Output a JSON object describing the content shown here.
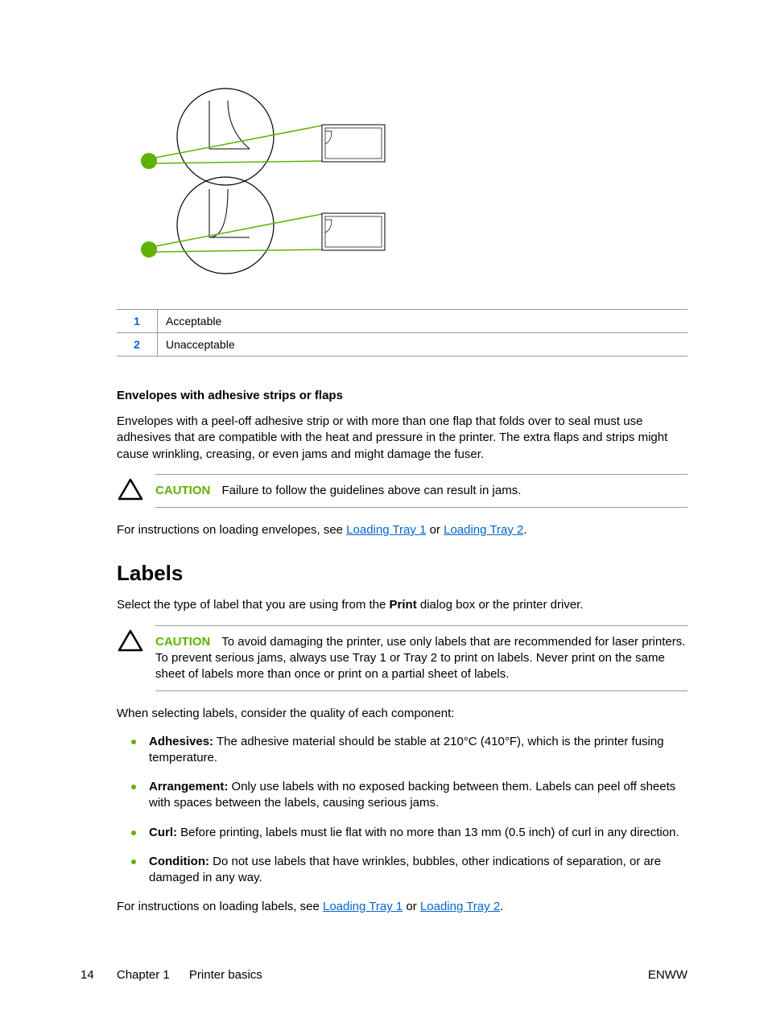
{
  "legend": {
    "row1_num": "1",
    "row1_text": "Acceptable",
    "row2_num": "2",
    "row2_text": "Unacceptable"
  },
  "sub_heading": "Envelopes with adhesive strips or flaps",
  "para_env": "Envelopes with a peel-off adhesive strip or with more than one flap that folds over to seal must use adhesives that are compatible with the heat and pressure in the printer. The extra flaps and strips might cause wrinkling, creasing, or even jams and might damage the fuser.",
  "caution1": {
    "label": "CAUTION",
    "text": "Failure to follow the guidelines above can result in jams."
  },
  "loading_env": {
    "pre": "For instructions on loading envelopes, see ",
    "link1": "Loading Tray 1",
    "or": " or ",
    "link2": "Loading Tray 2",
    "post": "."
  },
  "section_title": "Labels",
  "para_labels_intro_pre": "Select the type of label that you are using from the ",
  "para_labels_intro_bold": "Print",
  "para_labels_intro_post": " dialog box or the printer driver.",
  "caution2": {
    "label": "CAUTION",
    "text": "To avoid damaging the printer, use only labels that are recommended for laser printers. To prevent serious jams, always use Tray 1 or Tray 2 to print on labels. Never print on the same sheet of labels more than once or print on a partial sheet of labels."
  },
  "para_when": "When selecting labels, consider the quality of each component:",
  "bullets": {
    "b1_label": "Adhesives:",
    "b1_text": " The adhesive material should be stable at 210°C (410°F), which is the printer fusing temperature.",
    "b2_label": "Arrangement:",
    "b2_text": " Only use labels with no exposed backing between them. Labels can peel off sheets with spaces between the labels, causing serious jams.",
    "b3_label": "Curl:",
    "b3_text": " Before printing, labels must lie flat with no more than 13 mm (0.5 inch) of curl in any direction.",
    "b4_label": "Condition:",
    "b4_text": " Do not use labels that have wrinkles, bubbles, other indications of separation, or are damaged in any way."
  },
  "loading_labels": {
    "pre": "For instructions on loading labels, see ",
    "link1": "Loading Tray 1",
    "or": " or ",
    "link2": "Loading Tray 2",
    "post": "."
  },
  "footer": {
    "page": "14",
    "chapter": "Chapter 1",
    "title": "Printer basics",
    "right": "ENWW"
  }
}
